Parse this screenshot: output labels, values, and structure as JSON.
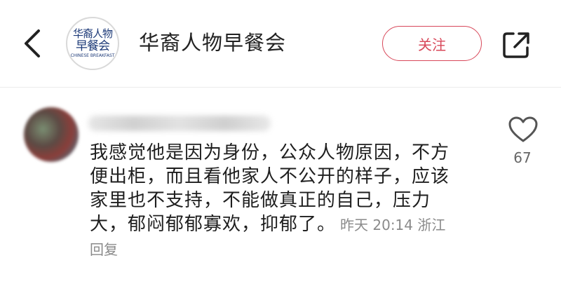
{
  "header": {
    "account_name": "华裔人物早餐会",
    "follow_label": "关注",
    "logo": {
      "line1": "华裔人物",
      "line2": "早餐会",
      "line3": "CHINESE BREAKFAST"
    }
  },
  "comment": {
    "text": "我感觉他是因为身份，公众人物原因，不方便出柜，而且看他家人不公开的样子，应该家里也不支持，不能做真正的自己，压力大，郁闷郁郁寡欢，抑郁了。",
    "time": "昨天 20:14",
    "location": "浙江",
    "reply_label": "回复",
    "like_count": "67"
  },
  "colors": {
    "accent": "#d8485a",
    "meta_text": "#8a8a8a",
    "logo_blue": "#1d3a78"
  },
  "icons": {
    "back": "chevron-left-icon",
    "share": "share-external-icon",
    "like": "heart-outline-icon"
  }
}
